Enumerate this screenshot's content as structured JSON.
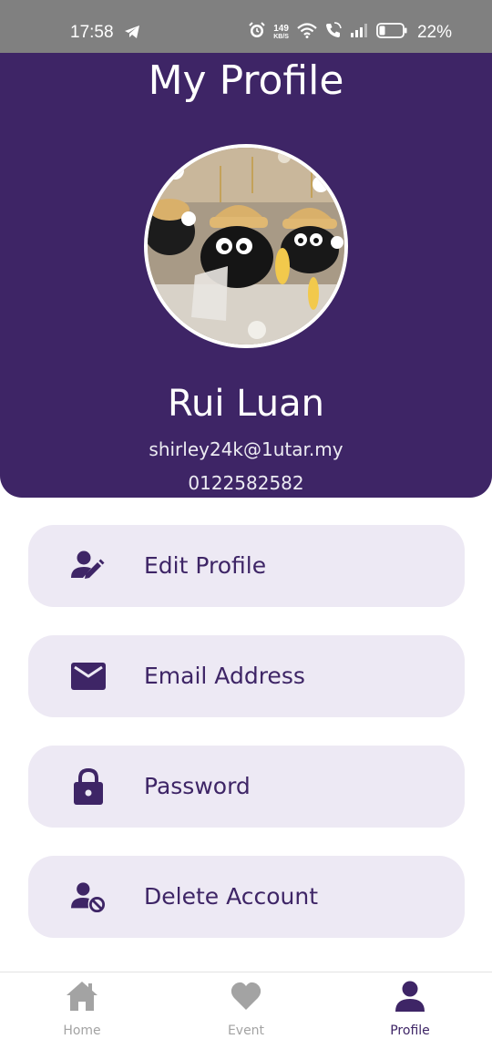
{
  "status_bar": {
    "time": "17:58",
    "left_icon": "telegram-icon",
    "net_speed_value": "149",
    "net_speed_unit": "KB/S",
    "battery": "22%",
    "icons": [
      "alarm-icon",
      "wifi-icon",
      "wifi-call-icon",
      "signal-icon",
      "battery-icon"
    ]
  },
  "header": {
    "title": "My Profile",
    "avatar_icon": "profile-photo",
    "name": "Rui Luan",
    "email": "shirley24k@1utar.my",
    "phone": "0122582582"
  },
  "menu": {
    "items": [
      {
        "label": "Edit Profile",
        "icon": "edit-person-icon"
      },
      {
        "label": "Email Address",
        "icon": "envelope-icon"
      },
      {
        "label": "Password",
        "icon": "lock-icon"
      },
      {
        "label": "Delete Account",
        "icon": "person-block-icon"
      }
    ]
  },
  "bottom_nav": {
    "items": [
      {
        "label": "Home",
        "icon": "home-icon",
        "active": false
      },
      {
        "label": "Event",
        "icon": "heart-icon",
        "active": false
      },
      {
        "label": "Profile",
        "icon": "person-icon",
        "active": true
      }
    ]
  },
  "colors": {
    "primary": "#3e2566",
    "card_bg": "#ede9f4",
    "status_bar": "#808080",
    "nav_inactive": "#a3a3a3"
  }
}
